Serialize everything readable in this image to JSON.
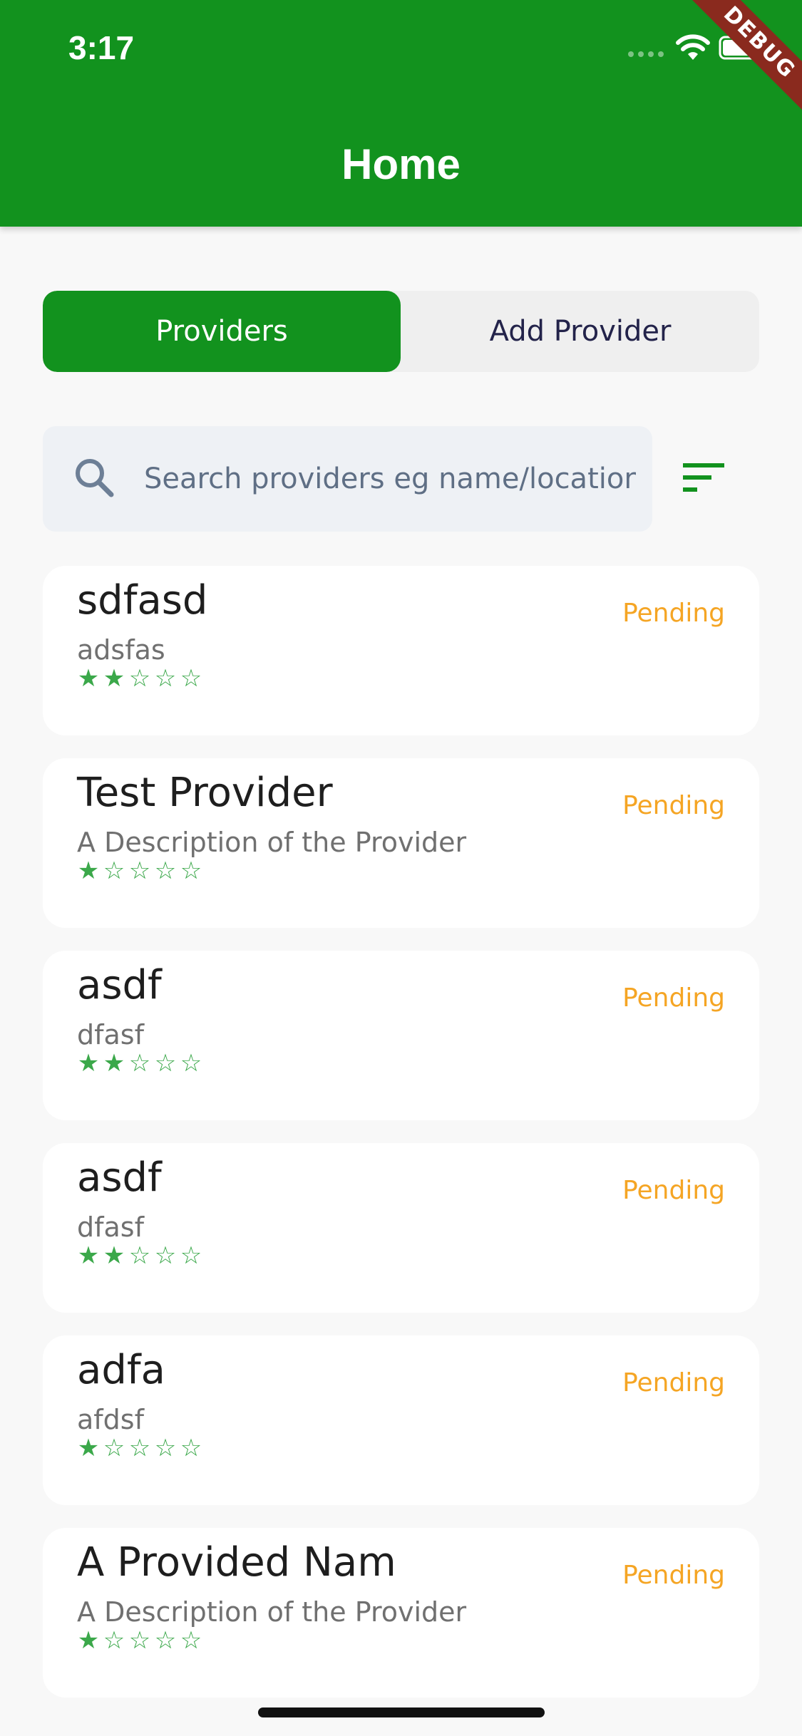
{
  "status_bar": {
    "time": "3:17"
  },
  "app_bar": {
    "title": "Home",
    "debug_label": "DEBUG",
    "background_color": "#12921e"
  },
  "tabs": [
    {
      "label": "Providers",
      "active": true
    },
    {
      "label": "Add Provider",
      "active": false
    }
  ],
  "search": {
    "placeholder": "Search providers eg name/location",
    "value": ""
  },
  "providers": [
    {
      "name": "sdfasd",
      "description": "adsfas",
      "rating": 2,
      "status": "Pending"
    },
    {
      "name": "Test Provider",
      "description": "A Description of the Provider",
      "rating": 1,
      "status": "Pending"
    },
    {
      "name": "asdf",
      "description": "dfasf",
      "rating": 2,
      "status": "Pending"
    },
    {
      "name": "asdf",
      "description": "dfasf",
      "rating": 2,
      "status": "Pending"
    },
    {
      "name": "adfa",
      "description": "afdsf",
      "rating": 1,
      "status": "Pending"
    },
    {
      "name": "A Provided Nam",
      "description": "A Description of the Provider",
      "rating": 1,
      "status": "Pending"
    }
  ],
  "colors": {
    "accent": "#12921e",
    "status_pending": "#f5a524",
    "star": "#3ba84a"
  },
  "icons": {
    "search": "search-icon",
    "filter": "filter-icon",
    "wifi": "wifi-icon",
    "battery": "battery-icon",
    "signal": "signal-icon"
  }
}
